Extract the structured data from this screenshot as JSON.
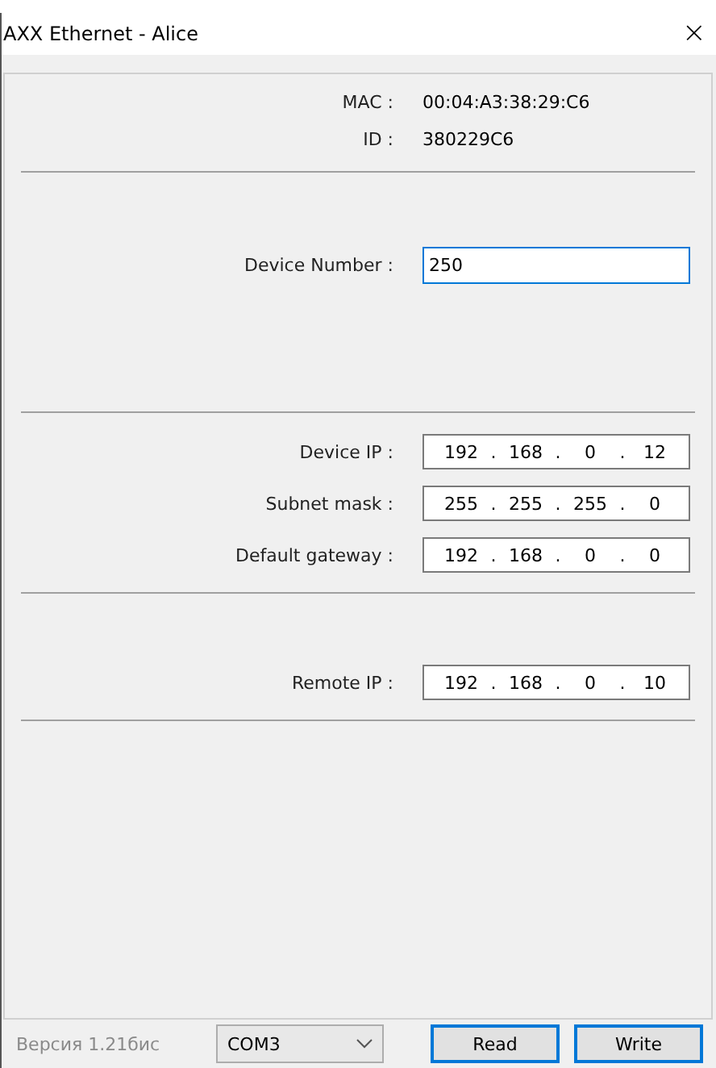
{
  "window": {
    "title": "AXX Ethernet - Alice",
    "close": "×"
  },
  "info": [
    {
      "label": "MAC :",
      "value": "00:04:A3:38:29:C6"
    },
    {
      "label": "ID :",
      "value": "380229C6"
    }
  ],
  "device_number": {
    "label": "Device Number :",
    "value": "250",
    "focused": true
  },
  "ip_sections": [
    {
      "fields": [
        {
          "label": "Device IP :",
          "octets": [
            "192",
            "168",
            "0",
            "12"
          ]
        },
        {
          "label": "Subnet mask :",
          "octets": [
            "255",
            "255",
            "255",
            "0"
          ]
        },
        {
          "label": "Default gateway :",
          "octets": [
            "192",
            "168",
            "0",
            "0"
          ]
        }
      ]
    },
    {
      "fields": [
        {
          "label": "Remote IP :",
          "octets": [
            "192",
            "168",
            "0",
            "10"
          ]
        }
      ]
    }
  ],
  "separator": ".",
  "footer": {
    "version": "Версия 1.21бис",
    "port": "COM3",
    "buttons": [
      "Read",
      "Write"
    ]
  }
}
